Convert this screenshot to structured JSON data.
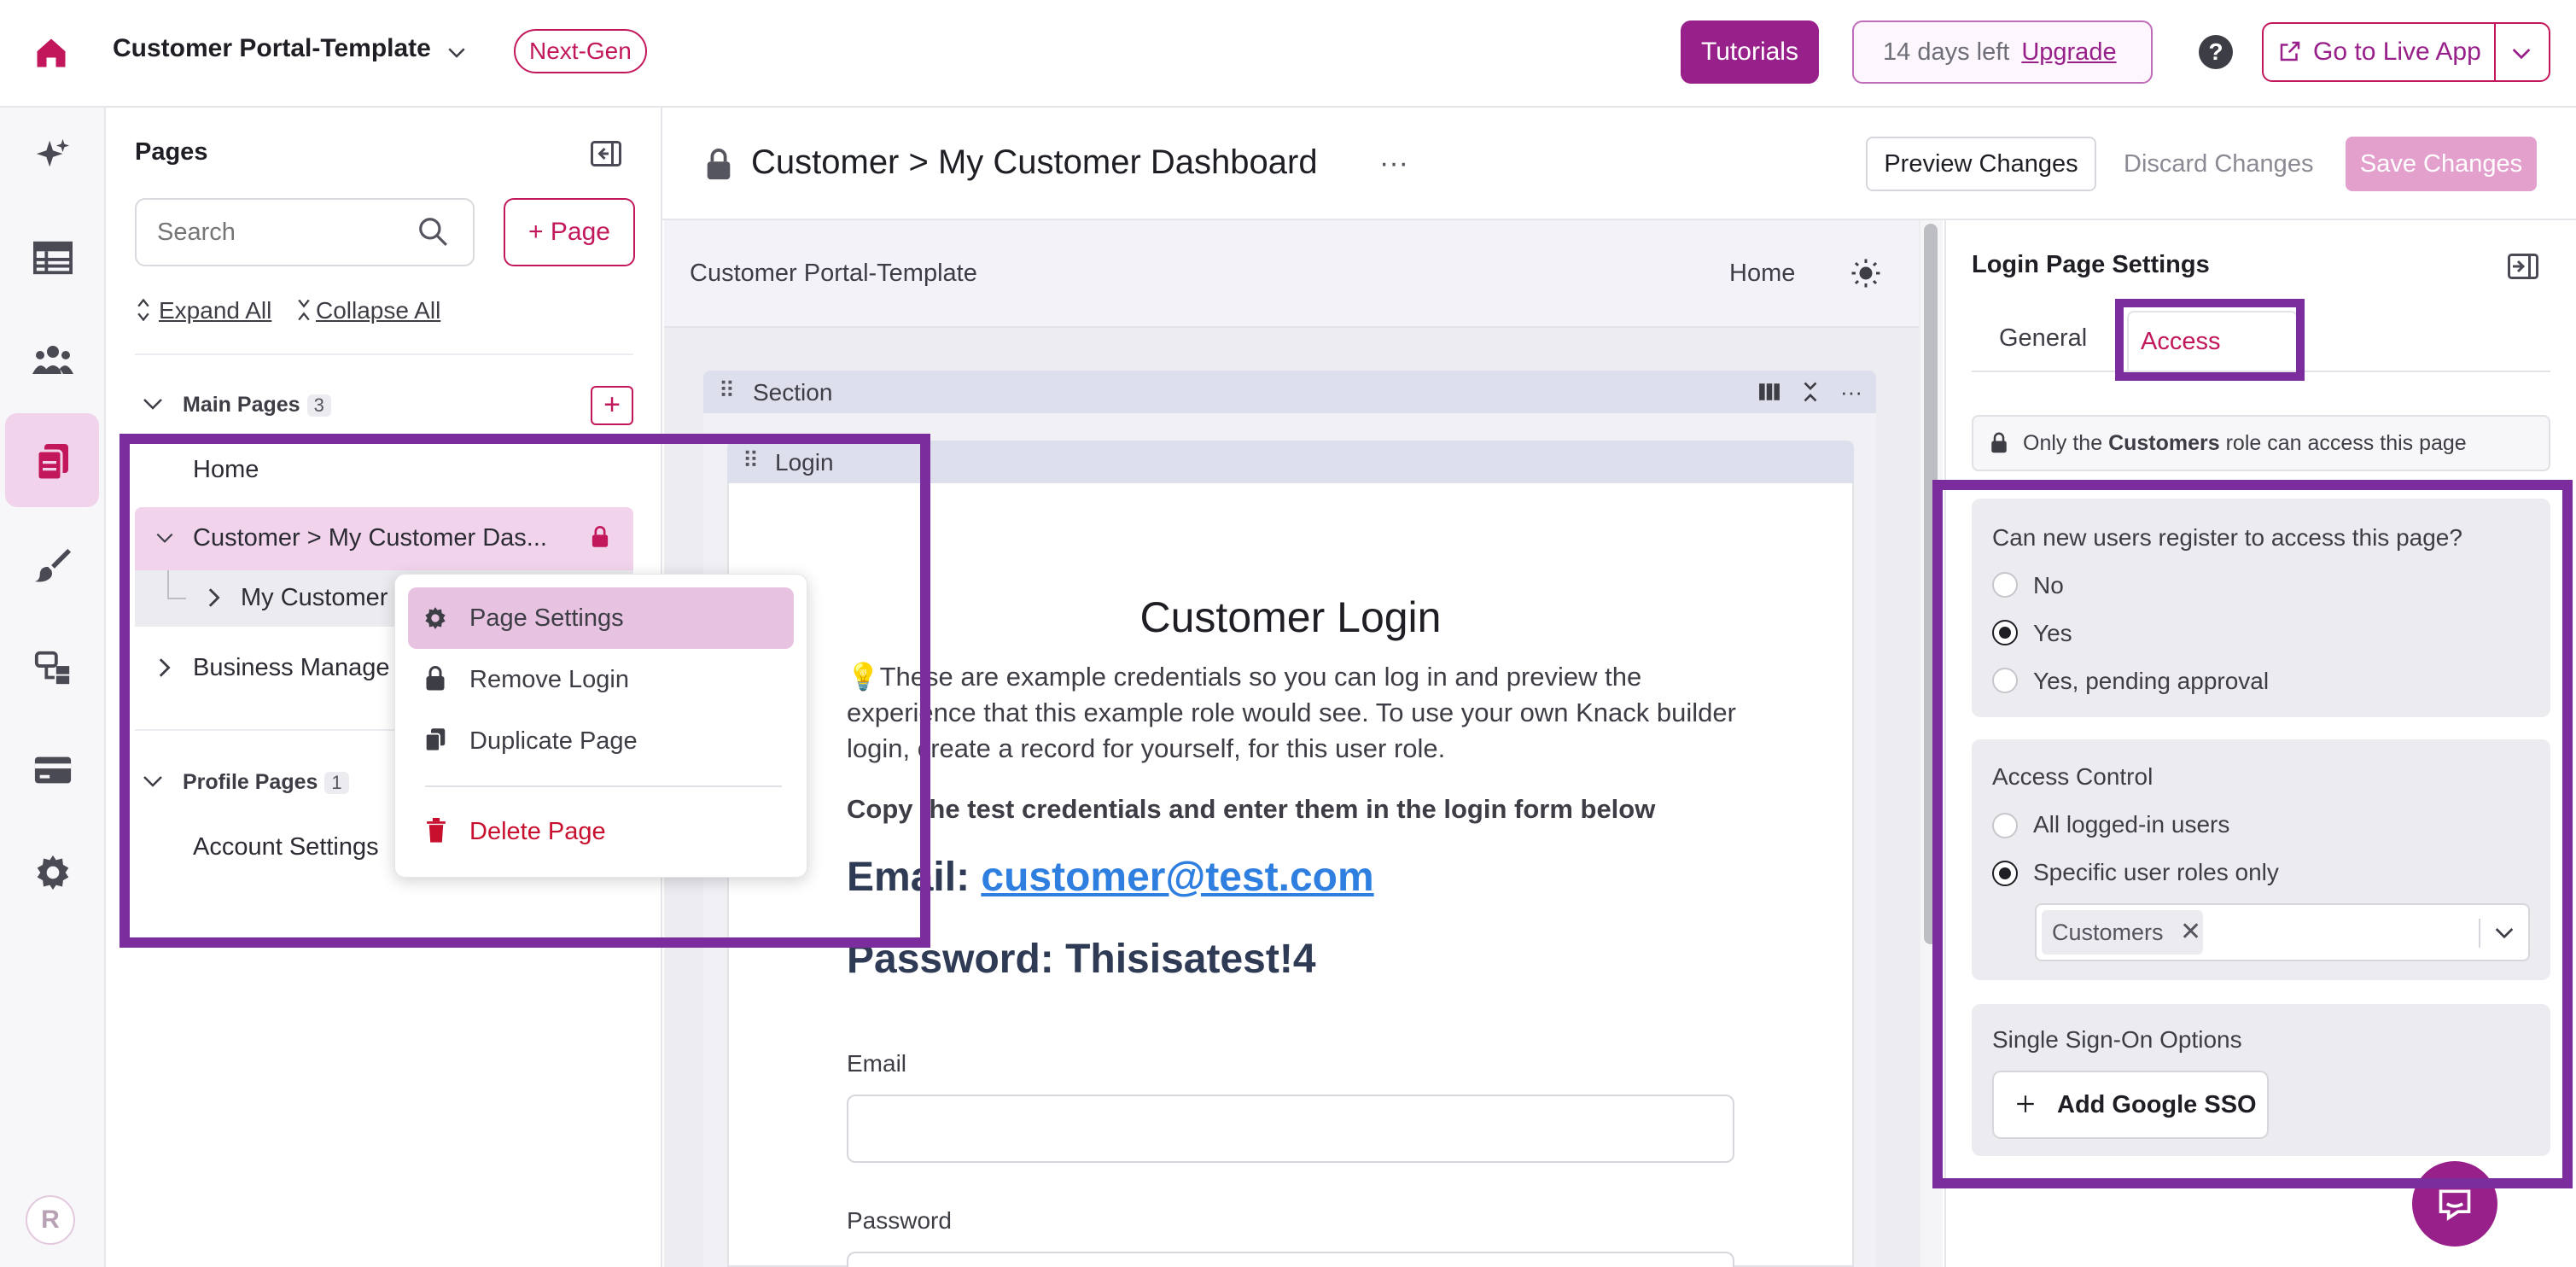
{
  "topbar": {
    "app_title": "Customer Portal-Template",
    "badge": "Next-Gen",
    "tutorials": "Tutorials",
    "trial_text": "14 days left",
    "upgrade": "Upgrade",
    "help": "?",
    "go_live": "Go to Live App"
  },
  "rail": {
    "avatar": "R",
    "icons": [
      "home-icon",
      "sparkle-icon",
      "table-icon",
      "users-icon",
      "pages-icon",
      "brush-icon",
      "flows-icon",
      "billing-icon",
      "gear-icon"
    ]
  },
  "pages_panel": {
    "title": "Pages",
    "search_placeholder": "Search",
    "add_page": "+ Page",
    "expand_all": "Expand All",
    "collapse_all": "Collapse All",
    "main_group": "Main Pages",
    "main_count": "3",
    "items": {
      "home": "Home",
      "customer": "Customer > My Customer Das...",
      "customer_child": "My Customer",
      "business": "Business Manage"
    },
    "profile_group": "Profile Pages",
    "profile_count": "1",
    "account": "Account Settings"
  },
  "context_menu": {
    "page_settings": "Page Settings",
    "remove_login": "Remove Login",
    "duplicate": "Duplicate Page",
    "delete": "Delete Page"
  },
  "editor": {
    "page_title": "Customer > My Customer Dashboard",
    "more": "···",
    "preview": "Preview Changes",
    "discard": "Discard Changes",
    "save": "Save Changes"
  },
  "canvas": {
    "site_name": "Customer Portal-Template",
    "nav_home": "Home",
    "section": "Section",
    "login_view": "Login",
    "heading": "Customer Login",
    "paragraph": "💡These are example credentials so you can log in and preview the experience that this example role would see. To use your own Knack builder login, create a record for yourself, for this user role.",
    "copy_line": "Copy the test credentials and enter them in the login form below",
    "email_prefix": "Email: ",
    "email": "customer@test.com",
    "password_line": "Password: Thisisatest!4",
    "email_label": "Email",
    "password_label": "Password"
  },
  "settings": {
    "title": "Login Page Settings",
    "tab_general": "General",
    "tab_access": "Access",
    "notice_pre": "Only the ",
    "notice_role": "Customers",
    "notice_post": " role can access this page",
    "register_q": "Can new users register to access this page?",
    "register_options": [
      "No",
      "Yes",
      "Yes, pending approval"
    ],
    "register_selected": "Yes",
    "access_title": "Access Control",
    "access_options": [
      "All logged-in users",
      "Specific user roles only"
    ],
    "access_selected": "Specific user roles only",
    "role_chip": "Customers",
    "sso_title": "Single Sign-On Options",
    "sso_button": "Add Google SSO"
  },
  "colors": {
    "brand": "#98208a",
    "accent": "#c2185b",
    "highlight": "#7b2d9e"
  }
}
